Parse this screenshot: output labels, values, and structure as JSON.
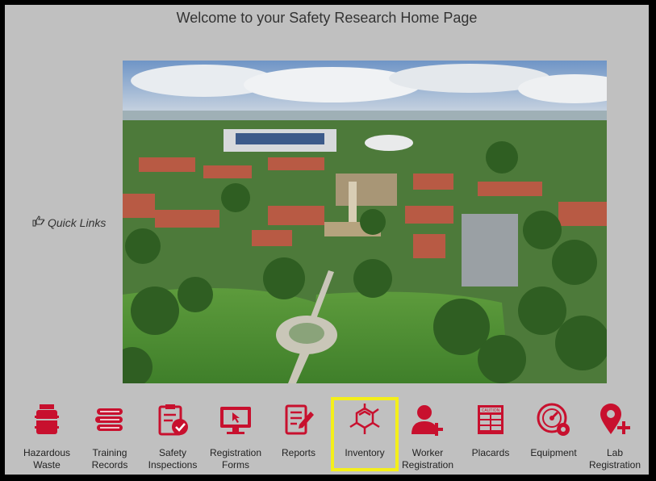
{
  "page": {
    "title": "Welcome to your Safety Research Home Page"
  },
  "quick_links": {
    "label": "Quick Links",
    "icon": "pointing-hand-icon"
  },
  "photo": {
    "alt": "Aerial campus photo"
  },
  "nav_tiles": [
    {
      "id": "hazardous-waste",
      "label": "Hazardous\nWaste",
      "icon": "barrel-icon"
    },
    {
      "id": "training-records",
      "label": "Training\nRecords",
      "icon": "books-icon"
    },
    {
      "id": "safety-inspections",
      "label": "Safety\nInspections",
      "icon": "checklist-icon"
    },
    {
      "id": "registration-forms",
      "label": "Registration\nForms",
      "icon": "monitor-icon"
    },
    {
      "id": "reports",
      "label": "Reports",
      "icon": "report-pen-icon"
    },
    {
      "id": "inventory",
      "label": "Inventory",
      "icon": "molecule-icon",
      "selected": true
    },
    {
      "id": "worker-registration",
      "label": "Worker\nRegistration",
      "icon": "user-plus-icon"
    },
    {
      "id": "placards",
      "label": "Placards",
      "icon": "caution-sign-icon"
    },
    {
      "id": "equipment",
      "label": "Equipment",
      "icon": "gauge-gear-icon"
    },
    {
      "id": "lab-registration",
      "label": "Lab\nRegistration",
      "icon": "location-plus-icon"
    }
  ],
  "colors": {
    "icon_red": "#c8102e",
    "selected_outline": "#f4ef1a",
    "background": "#c0c0c0"
  }
}
